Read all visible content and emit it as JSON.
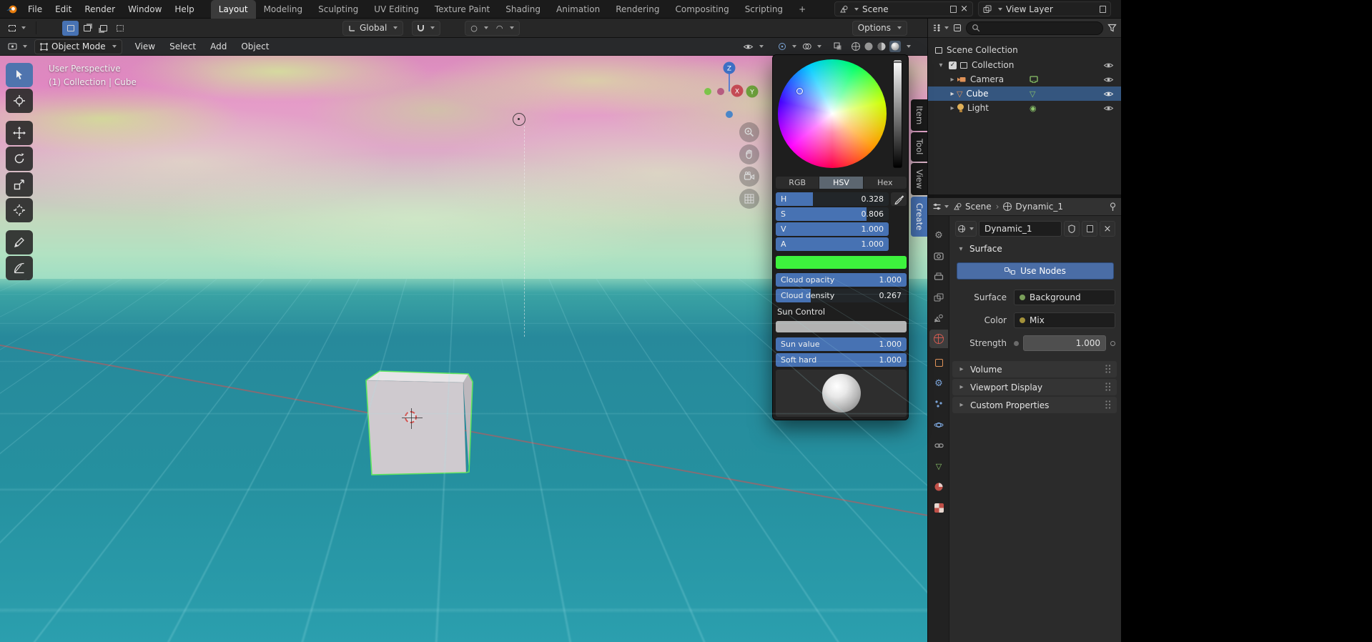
{
  "colors": {
    "accent": "#4772b3",
    "selected_row": "#35567f",
    "swatch": "#3df23d",
    "sky_top": "#db8bbd",
    "ground_teal": "#27899b",
    "object_orange": "#e09258",
    "data_green": "#8bc46a"
  },
  "topbar": {
    "menus": [
      "File",
      "Edit",
      "Render",
      "Window",
      "Help"
    ],
    "workspaces": [
      "Layout",
      "Modeling",
      "Sculpting",
      "UV Editing",
      "Texture Paint",
      "Shading",
      "Animation",
      "Rendering",
      "Compositing",
      "Scripting"
    ],
    "active_workspace": "Layout",
    "add_workspace": "+",
    "scene_selector": {
      "label": "Scene"
    },
    "view_layer_selector": {
      "label": "View Layer"
    }
  },
  "tool_settings": {
    "orientation": "Global",
    "options_label": "Options"
  },
  "viewport": {
    "mode": "Object Mode",
    "menus": [
      "View",
      "Select",
      "Add",
      "Object"
    ],
    "overlay": {
      "line1": "User Perspective",
      "line2": "(1) Collection | Cube"
    },
    "gizmo": {
      "x": "X",
      "y": "Y",
      "z": "Z"
    }
  },
  "sidebar_tabs": {
    "items": [
      "Item",
      "Tool",
      "View",
      "Create"
    ],
    "active": "Create"
  },
  "color_picker": {
    "tabs": [
      "RGB",
      "HSV",
      "Hex"
    ],
    "active_tab": "HSV",
    "sliders": [
      {
        "label": "H",
        "value": "0.328",
        "fraction": 0.328
      },
      {
        "label": "S",
        "value": "0.806",
        "fraction": 0.806
      },
      {
        "label": "V",
        "value": "1.000",
        "fraction": 1
      },
      {
        "label": "A",
        "value": "1.000",
        "fraction": 1
      }
    ],
    "swatch_color": "#3df23d",
    "params": [
      {
        "label": "Cloud opacity",
        "value": "1.000",
        "fraction": 1
      },
      {
        "label": "Cloud density",
        "value": "0.267",
        "fraction": 0.267
      }
    ],
    "sun_section": "Sun Control",
    "sun_params": [
      {
        "label": "Sun value",
        "value": "1.000",
        "fraction": 1
      },
      {
        "label": "Soft hard",
        "value": "1.000",
        "fraction": 1
      }
    ]
  },
  "outliner": {
    "rows": [
      {
        "label": "Scene Collection"
      },
      {
        "label": "Collection"
      },
      {
        "label": "Camera"
      },
      {
        "label": "Cube"
      },
      {
        "label": "Light"
      }
    ],
    "selected": "Cube"
  },
  "properties": {
    "header": {
      "scene": "Scene",
      "world": "Dynamic_1"
    },
    "world": {
      "name": "Dynamic_1"
    },
    "surface_panel": {
      "title": "Surface",
      "use_nodes": "Use Nodes",
      "surface_label": "Surface",
      "surface_value": "Background",
      "color_label": "Color",
      "color_value": "Mix",
      "strength_label": "Strength",
      "strength_value": "1.000"
    },
    "collapsed_panels": [
      "Volume",
      "Viewport Display",
      "Custom Properties"
    ],
    "active_tab": "world"
  }
}
